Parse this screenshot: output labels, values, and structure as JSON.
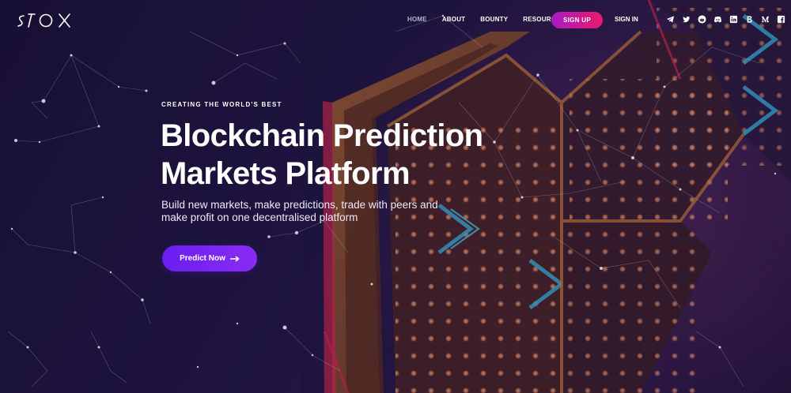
{
  "nav": {
    "links": [
      {
        "label": "HOME",
        "active": true
      },
      {
        "label": "ABOUT"
      },
      {
        "label": "BOUNTY"
      },
      {
        "label": "RESOURCES"
      }
    ],
    "signup_label": "SIGN UP",
    "signin_label": "SIGN IN",
    "socials": [
      "telegram-icon",
      "twitter-icon",
      "reddit-icon",
      "discord-icon",
      "linkedin-icon",
      "bitcoin-icon",
      "medium-icon",
      "facebook-icon"
    ]
  },
  "hero": {
    "eyebrow": "CREATING THE WORLD'S BEST",
    "headline_line1": "Blockchain Prediction",
    "headline_line2": "Markets Platform",
    "subtitle_line1": "Build new markets, make predictions, trade with peers and",
    "subtitle_line2": "make profit on one decentralised platform",
    "cta_label": "Predict Now"
  },
  "colors": {
    "background": "#1c1236",
    "signup_gradient_start": "#a51cc4",
    "signup_gradient_end": "#ec1a6a",
    "cta": "#7424f2"
  }
}
